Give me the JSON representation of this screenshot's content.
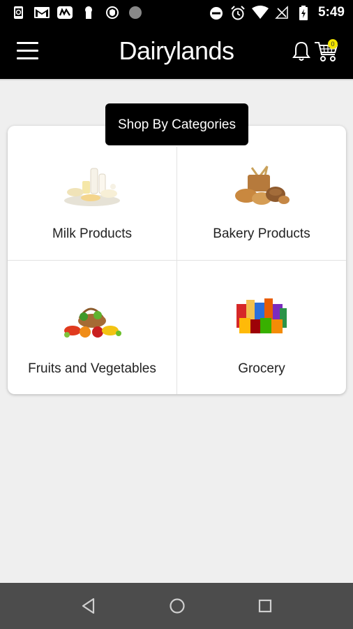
{
  "status_bar": {
    "time": "5:49",
    "icons": [
      "phone-sync-icon",
      "gmail-icon",
      "maps-icon",
      "keyhole-icon",
      "shield-icon",
      "circle-icon",
      "do-not-disturb-icon",
      "alarm-icon",
      "wifi-icon",
      "no-signal-icon",
      "battery-charging-icon"
    ]
  },
  "app_bar": {
    "title": "Dairylands",
    "cart_count": "0",
    "icons": [
      "menu-icon",
      "bell-icon",
      "cart-icon"
    ]
  },
  "categories": {
    "heading": "Shop By Categories",
    "items": [
      {
        "label": "Milk Products",
        "icon": "milk-products-image"
      },
      {
        "label": "Bakery Products",
        "icon": "bakery-products-image"
      },
      {
        "label": "Fruits and Vegetables",
        "icon": "fruits-vegetables-image"
      },
      {
        "label": "Grocery",
        "icon": "grocery-image"
      }
    ]
  },
  "nav_bar": {
    "icons": [
      "back-icon",
      "home-icon",
      "recents-icon"
    ]
  },
  "colors": {
    "app_bar": "#000000",
    "background": "#efefef",
    "badge": "#f3e500",
    "nav_bar": "#4c4c4c"
  }
}
